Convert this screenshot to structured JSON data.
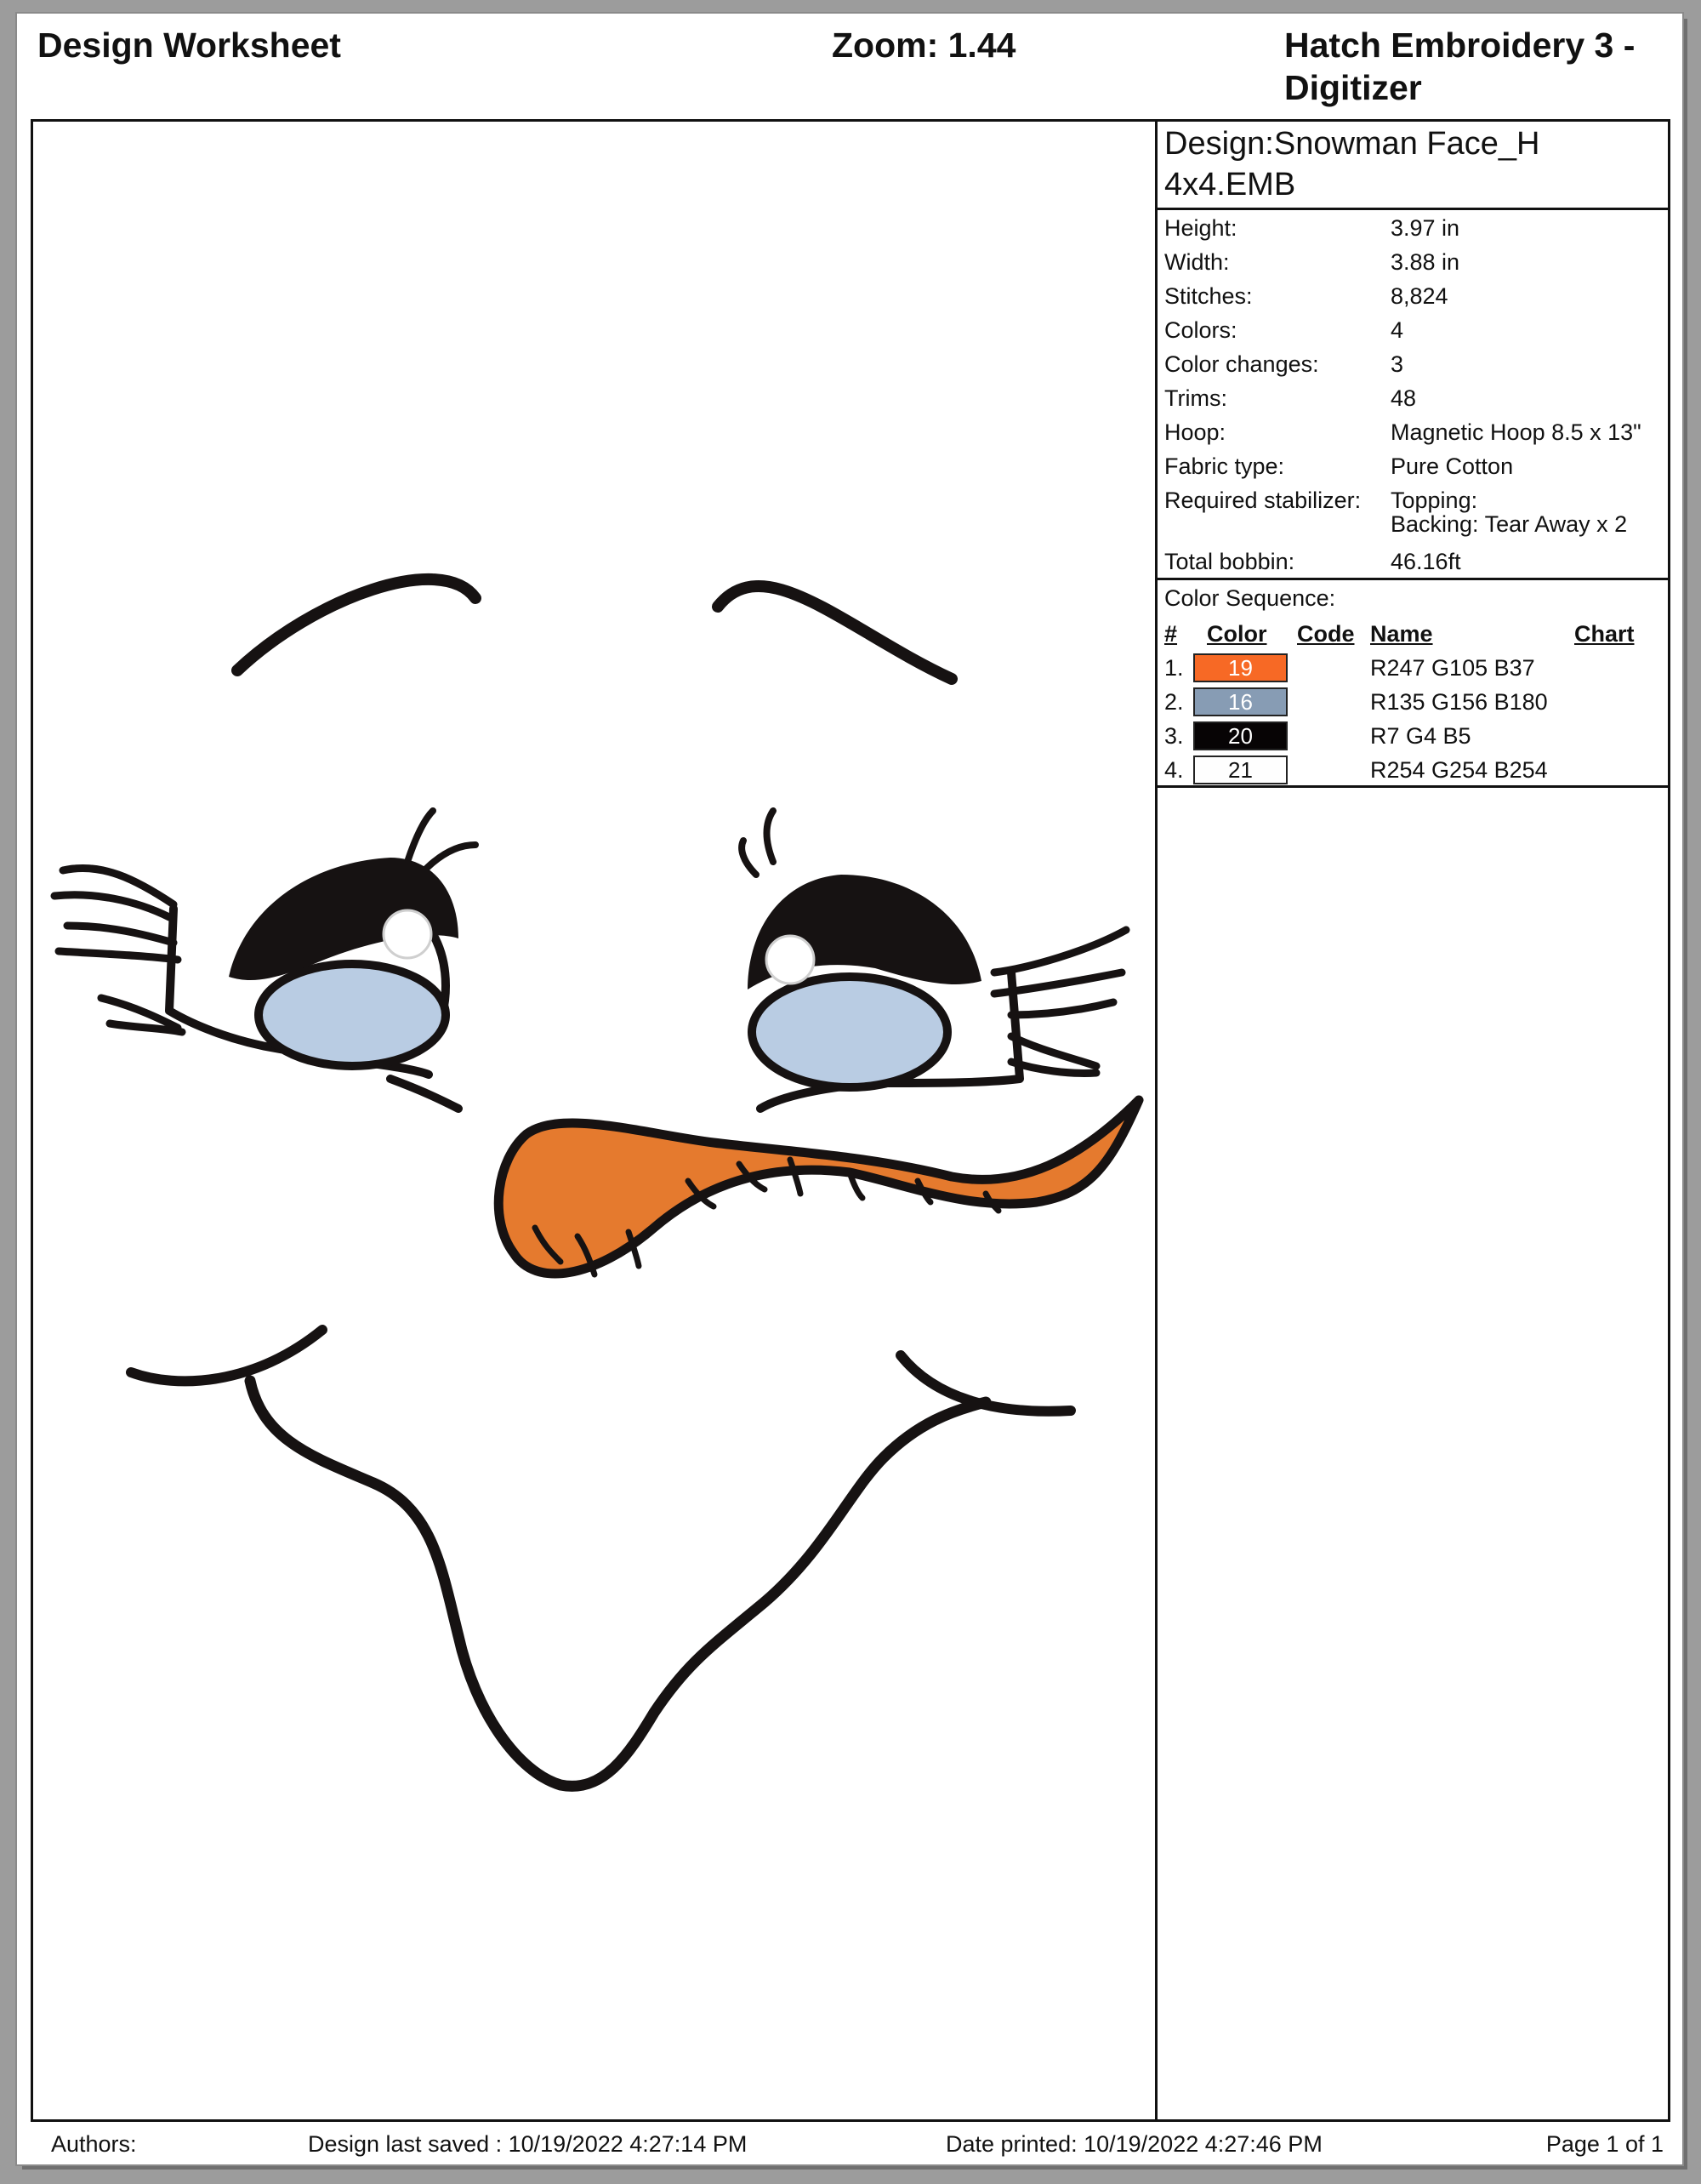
{
  "header": {
    "title": "Design Worksheet",
    "zoom": "Zoom:  1.44",
    "app_name": "Hatch Embroidery 3 - Digitizer"
  },
  "design": {
    "name": "Design:Snowman Face_H 4x4.EMB"
  },
  "properties": [
    {
      "label": "Height:",
      "value": "3.97 in"
    },
    {
      "label": "Width:",
      "value": "3.88 in"
    },
    {
      "label": "Stitches:",
      "value": "8,824"
    },
    {
      "label": "Colors:",
      "value": "4"
    },
    {
      "label": "Color changes:",
      "value": "3"
    },
    {
      "label": "Trims:",
      "value": "48"
    },
    {
      "label": "Hoop:",
      "value": "Magnetic Hoop 8.5 x 13\""
    },
    {
      "label": "Fabric type:",
      "value": "Pure Cotton"
    },
    {
      "label": "Required stabilizer:",
      "value": "Topping:",
      "value2": "Backing: Tear Away x 2"
    },
    {
      "label": "Total bobbin:",
      "value": "46.16ft"
    }
  ],
  "color_sequence": {
    "label": "Color Sequence:",
    "headers": {
      "num": "#",
      "color": "Color",
      "code": "Code",
      "name": "Name",
      "chart": "Chart"
    },
    "rows": [
      {
        "num": "1.",
        "code": "19",
        "name": "R247 G105 B37",
        "color": "#F76925",
        "text_color": "#ffffff"
      },
      {
        "num": "2.",
        "code": "16",
        "name": "R135 G156 B180",
        "color": "#879CB4",
        "text_color": "#ffffff"
      },
      {
        "num": "3.",
        "code": "20",
        "name": "R7 G4 B5",
        "color": "#070405",
        "text_color": "#ffffff"
      },
      {
        "num": "4.",
        "code": "21",
        "name": "R254 G254 B254",
        "color": "#FEFEFE",
        "text_color": "#111111"
      }
    ]
  },
  "footer": {
    "authors": "Authors:",
    "last_saved": "Design last saved : 10/19/2022 4:27:14 PM",
    "date_printed": "Date printed: 10/19/2022 4:27:46 PM",
    "page": "Page 1 of 1"
  },
  "palette": {
    "thread_black": "#161212",
    "thread_orange": "#E57A2E",
    "thread_blue": "#B9CCE3"
  }
}
